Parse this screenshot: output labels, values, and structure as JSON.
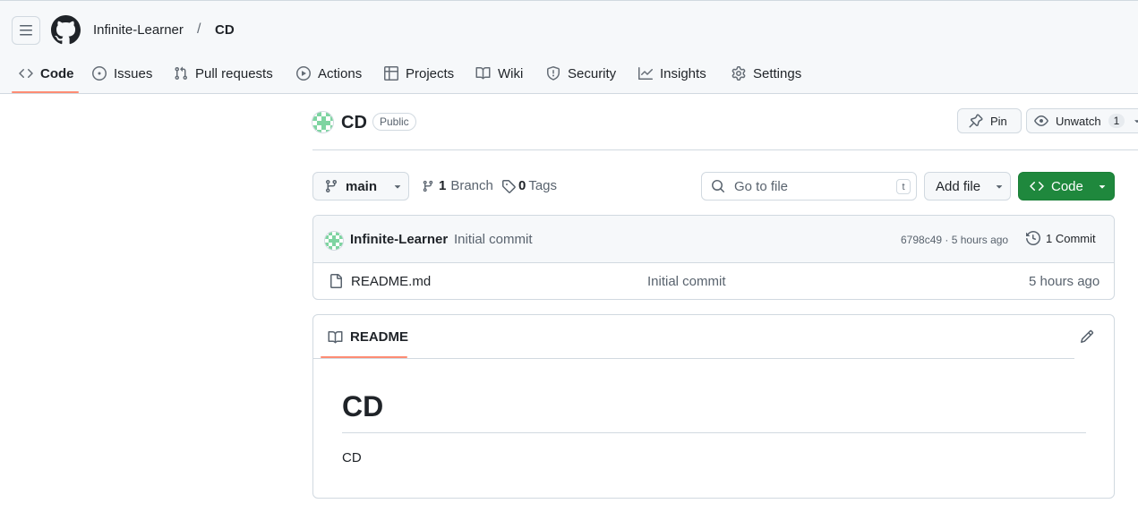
{
  "header": {
    "owner": "Infinite-Learner",
    "separator": "/",
    "repo": "CD"
  },
  "tabs": [
    {
      "label": "Code",
      "icon": "code-icon"
    },
    {
      "label": "Issues",
      "icon": "issue-opened-icon"
    },
    {
      "label": "Pull requests",
      "icon": "git-pull-request-icon"
    },
    {
      "label": "Actions",
      "icon": "play-icon"
    },
    {
      "label": "Projects",
      "icon": "table-icon"
    },
    {
      "label": "Wiki",
      "icon": "book-icon"
    },
    {
      "label": "Security",
      "icon": "shield-icon"
    },
    {
      "label": "Insights",
      "icon": "graph-icon"
    },
    {
      "label": "Settings",
      "icon": "gear-icon"
    }
  ],
  "repo_header": {
    "name": "CD",
    "visibility": "Public",
    "pin_label": "Pin",
    "unwatch_label": "Unwatch",
    "watch_count": "1"
  },
  "toolbar": {
    "branch": "main",
    "branch_count": "1",
    "branch_label": "Branch",
    "tag_count": "0",
    "tag_label": "Tags",
    "search_placeholder": "Go to file",
    "search_shortcut": "t",
    "add_file_label": "Add file",
    "code_label": "Code"
  },
  "latest_commit": {
    "author": "Infinite-Learner",
    "message": "Initial commit",
    "meta": "6798c49 · 5 hours ago",
    "commits_label": "1 Commit"
  },
  "files": [
    {
      "name": "README.md",
      "message": "Initial commit",
      "time": "5 hours ago"
    }
  ],
  "readme": {
    "tab_label": "README",
    "heading": "CD",
    "body": "CD"
  },
  "colors": {
    "accent_underline": "#fd8c73",
    "primary_button": "#1f883d",
    "border": "#d1d9e0",
    "muted_text": "#59636e"
  }
}
